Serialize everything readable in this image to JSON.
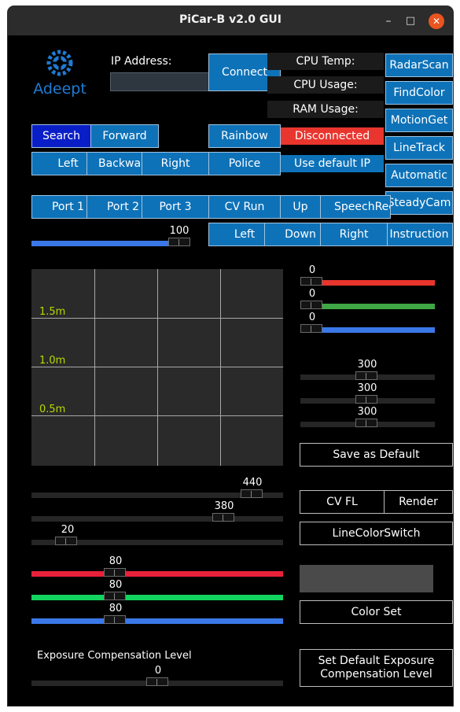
{
  "window": {
    "title": "PiCar-B v2.0 GUI",
    "minimize": "–",
    "maximize": "□",
    "close": "✕"
  },
  "logo": {
    "text": "Adeept",
    "color": "#1f7bd4"
  },
  "ip": {
    "label": "IP Address:",
    "value": "",
    "connect": "Connect"
  },
  "status": {
    "cpu_temp": "CPU Temp:",
    "cpu_usage": "CPU Usage:",
    "ram_usage": "RAM Usage:",
    "connection": "Disconnected",
    "default_ip": "Use default IP"
  },
  "side_buttons": [
    "RadarScan",
    "FindColor",
    "MotionGet",
    "LineTrack",
    "Automatic",
    "SteadyCam",
    "Instruction"
  ],
  "move": {
    "search": "Search",
    "forward": "Forward",
    "left": "Left",
    "backward": "Backward",
    "right": "Right"
  },
  "lights": {
    "rainbow": "Rainbow",
    "police": "Police"
  },
  "ports": [
    "Port 1",
    "Port 2",
    "Port 3"
  ],
  "cv": {
    "cv_run": "CV Run",
    "up": "Up",
    "speech": "SpeechRecog",
    "left": "Left",
    "down": "Down",
    "right": "Right"
  },
  "speed": {
    "value": "100",
    "fraction": 1.0,
    "color": "#3b78e7"
  },
  "radar": {
    "labels": [
      "1.5m",
      "1.0m",
      "0.5m"
    ]
  },
  "rgb_sliders": [
    {
      "value": "0",
      "fraction": 0.0,
      "color": "#e8352e"
    },
    {
      "value": "0",
      "fraction": 0.0,
      "color": "#3fa845"
    },
    {
      "value": "0",
      "fraction": 0.0,
      "color": "#3b78e7"
    }
  ],
  "right_sliders": [
    {
      "value": "300"
    },
    {
      "value": "300"
    },
    {
      "value": "300"
    }
  ],
  "actions": {
    "save_default": "Save as Default",
    "cv_fl": "CV FL",
    "render": "Render",
    "line_color_switch": "LineColorSwitch",
    "color_set": "Color Set",
    "set_exposure": "Set Default Exposure\nCompensation Level"
  },
  "left_sliders": [
    {
      "value": "440"
    },
    {
      "value": "380"
    },
    {
      "value": "20"
    }
  ],
  "color_sliders": [
    {
      "value": "80",
      "color": "#e8213a"
    },
    {
      "value": "80",
      "color": "#12d45e"
    },
    {
      "value": "80",
      "color": "#3b78e7"
    }
  ],
  "exposure": {
    "label": "Exposure Compensation Level",
    "value": "0"
  }
}
